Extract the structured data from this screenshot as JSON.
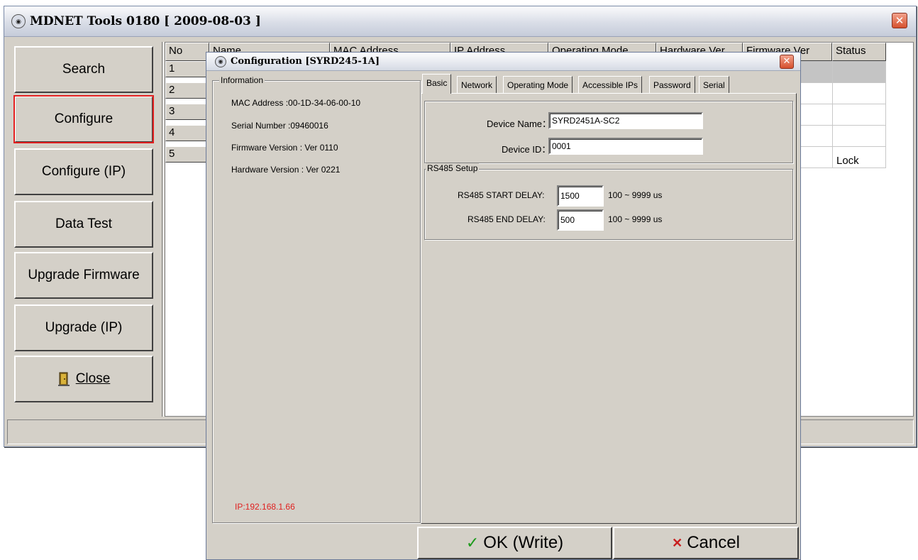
{
  "main_window": {
    "title": "MDNET Tools 0180   [ 2009-08-03 ]",
    "app_icon": "device-icon",
    "close_glyph": "✕"
  },
  "sidebar": {
    "buttons": [
      {
        "label": "Search"
      },
      {
        "label": "Configure"
      },
      {
        "label": "Configure (IP)"
      },
      {
        "label": "Data Test"
      },
      {
        "label": "Upgrade Firmware"
      },
      {
        "label": "Upgrade (IP)"
      },
      {
        "label": "Close",
        "icon": "door-exit-icon"
      }
    ]
  },
  "table": {
    "headers": {
      "no": "No",
      "name": "Name",
      "mac": "MAC Address",
      "ip": "IP Address",
      "mode": "Operating Mode",
      "hw": "Hardware Ver",
      "fw": "Firmware Ver",
      "status": "Status"
    },
    "rows": [
      {
        "no": "1",
        "status": ""
      },
      {
        "no": "2",
        "status": ""
      },
      {
        "no": "3",
        "status": ""
      },
      {
        "no": "4",
        "status": ""
      },
      {
        "no": "5",
        "status": "Lock"
      }
    ]
  },
  "dialog": {
    "title": "Configuration [SYRD245-1A]",
    "close_glyph": "✕",
    "info": {
      "group_label": "Information",
      "mac": "MAC Address :00-1D-34-06-00-10",
      "serial": "Serial Number :09460016",
      "firmware": "Firmware Version : Ver 0110",
      "hardware": "Hardware Version : Ver 0221",
      "ip": "IP:192.168.1.66"
    },
    "tabs": [
      "Basic",
      "Network",
      "Operating Mode",
      "Accessible IPs",
      "Password",
      "Serial"
    ],
    "basic": {
      "device_name_label": "Device Name：",
      "device_name_value": "SYRD2451A-SC2",
      "device_id_label": "Device ID：",
      "device_id_value": "0001",
      "rs485_group": "RS485 Setup",
      "start_delay_label": "RS485 START DELAY:",
      "start_delay_value": "1500",
      "start_delay_range": "100 ~ 9999 us",
      "end_delay_label": "RS485 END DELAY:",
      "end_delay_value": "500",
      "end_delay_range": "100 ~ 9999 us"
    },
    "ok_label": "OK (Write)",
    "ok_icon": "✓",
    "cancel_label": "Cancel",
    "cancel_icon": "✕"
  },
  "colors": {
    "highlight_border": "#e22020",
    "ip_text": "#e02020",
    "ok_check": "#1a9a1a",
    "cancel_x": "#c81e1e"
  }
}
